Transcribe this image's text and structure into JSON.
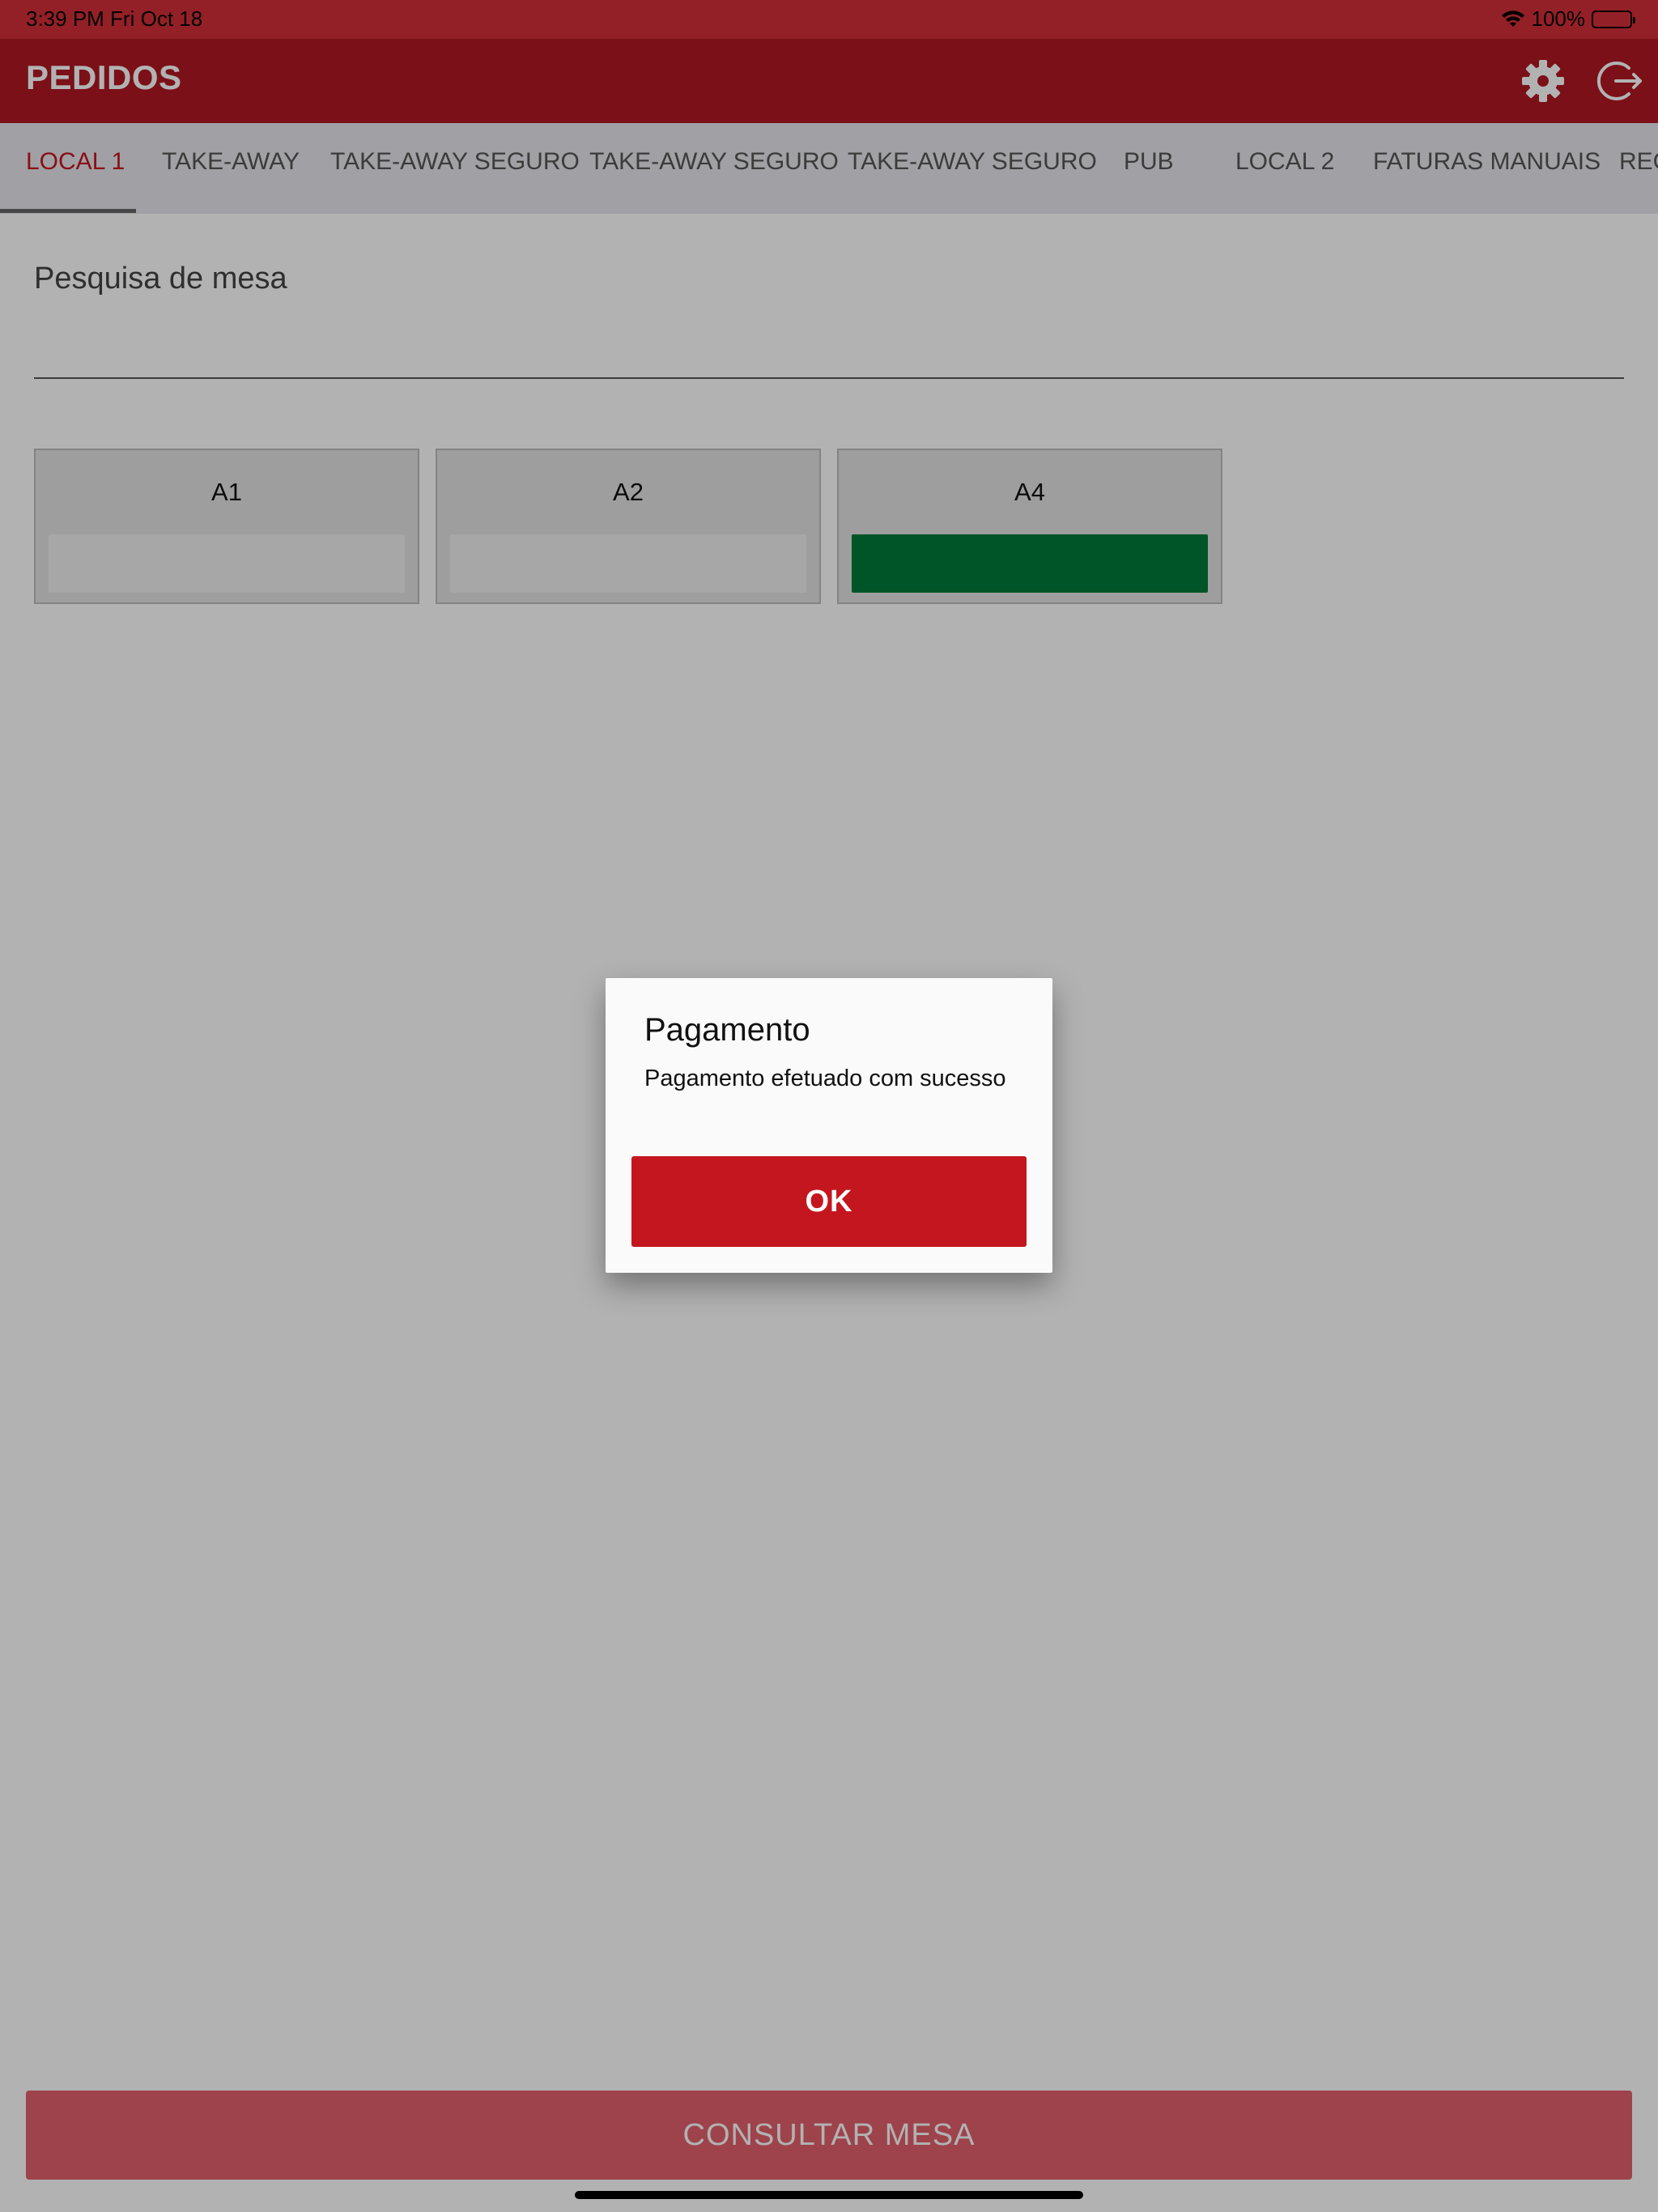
{
  "status_bar": {
    "time_date": "3:39 PM   Fri Oct 18",
    "battery": "100%"
  },
  "header": {
    "title": "PEDIDOS",
    "settings_icon": "gear-icon",
    "logout_icon": "logout-icon"
  },
  "tabs": [
    {
      "label": "LOCAL 1",
      "active": true
    },
    {
      "label": "TAKE-AWAY"
    },
    {
      "label": "TAKE-AWAY SEGURO"
    },
    {
      "label": "TAKE-AWAY SEGURO"
    },
    {
      "label": "TAKE-AWAY SEGURO"
    },
    {
      "label": "PUB"
    },
    {
      "label": "LOCAL 2"
    },
    {
      "label": "FATURAS MANUAIS"
    },
    {
      "label": "REC"
    }
  ],
  "search": {
    "label": "Pesquisa de mesa",
    "value": ""
  },
  "tables": [
    {
      "name": "A1",
      "status": "free"
    },
    {
      "name": "A2",
      "status": "free"
    },
    {
      "name": "A4",
      "status": "occupied"
    }
  ],
  "bottom_button": {
    "label": "CONSULTAR MESA"
  },
  "dialog": {
    "title": "Pagamento",
    "message": "Pagamento efetuado com sucesso",
    "ok_label": "OK"
  },
  "colors": {
    "primary": "#c4161f",
    "status_bar": "#d42f38",
    "app_bar": "#b01823",
    "occupied": "#007a3a"
  }
}
